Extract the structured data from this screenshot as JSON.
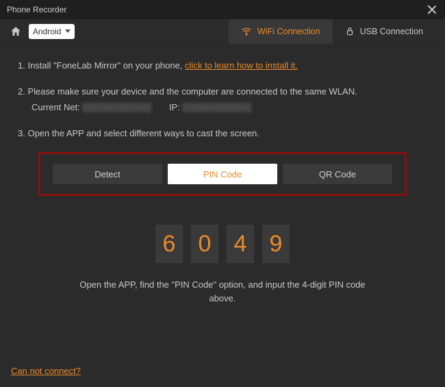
{
  "titlebar": {
    "title": "Phone Recorder"
  },
  "toolbar": {
    "device_dropdown": "Android",
    "tabs": {
      "wifi": "WiFi Connection",
      "usb": "USB Connection"
    }
  },
  "steps": {
    "s1_prefix": "1. Install \"FoneLab Mirror\" on your phone, ",
    "s1_link": "click to learn how to install it.",
    "s2": "2. Please make sure your device and the computer are connected to the same WLAN.",
    "s2_net_label": "Current Net:",
    "s2_ip_label": "IP:",
    "s3": "3. Open the APP and select different ways to cast the screen."
  },
  "segments": {
    "detect": "Detect",
    "pin": "PIN Code",
    "qr": "QR Code"
  },
  "pin": {
    "d0": "6",
    "d1": "0",
    "d2": "4",
    "d3": "9"
  },
  "pin_hint": "Open the APP, find the \"PIN Code\" option, and input the 4-digit PIN code above.",
  "footer": {
    "cannot_connect": "Can not connect?"
  }
}
